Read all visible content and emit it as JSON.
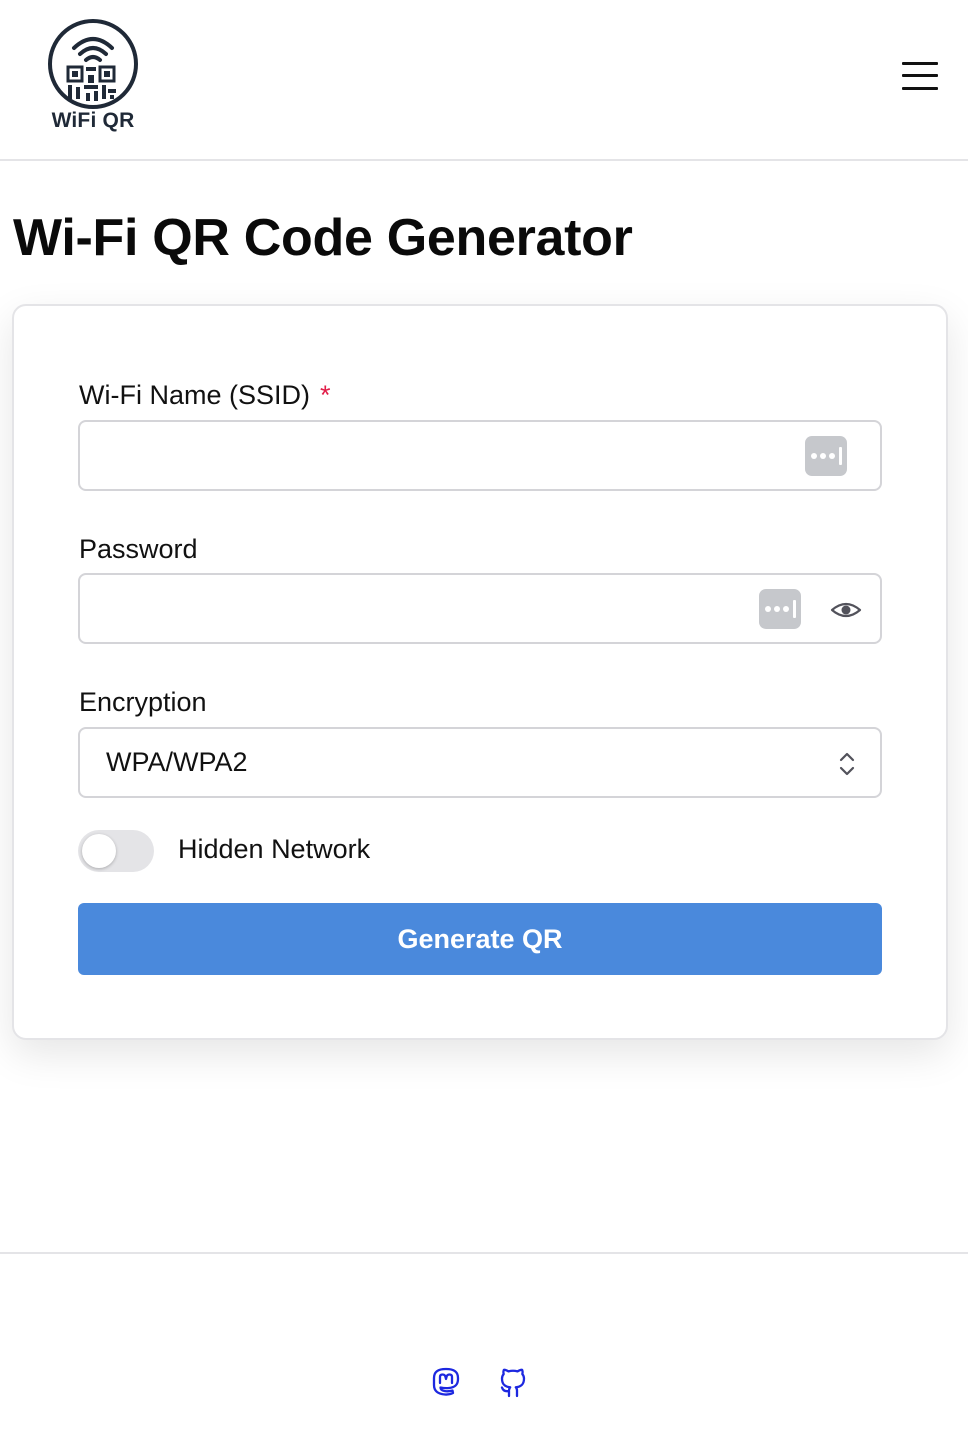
{
  "header": {
    "logo_text": "WiFi QR",
    "menu_icon": "hamburger-menu-icon"
  },
  "page": {
    "title": "Wi-Fi QR Code Generator"
  },
  "form": {
    "ssid": {
      "label": "Wi-Fi Name (SSID)",
      "required_mark": "*",
      "value": "",
      "icon": "password-manager-key-icon"
    },
    "password": {
      "label": "Password",
      "value": "",
      "icon": "password-manager-key-icon",
      "visibility_icon": "eye-icon"
    },
    "encryption": {
      "label": "Encryption",
      "selected": "WPA/WPA2",
      "icon": "chevron-up-down-icon"
    },
    "hidden_network": {
      "label": "Hidden Network",
      "checked": false
    },
    "submit_label": "Generate QR"
  },
  "footer": {
    "links": [
      {
        "icon": "mastodon-icon"
      },
      {
        "icon": "github-icon"
      }
    ]
  },
  "colors": {
    "primary_button": "#4a89dc",
    "required_asterisk": "#e11d48",
    "link_icon": "#1d28e0",
    "border": "#d4d4d8"
  }
}
